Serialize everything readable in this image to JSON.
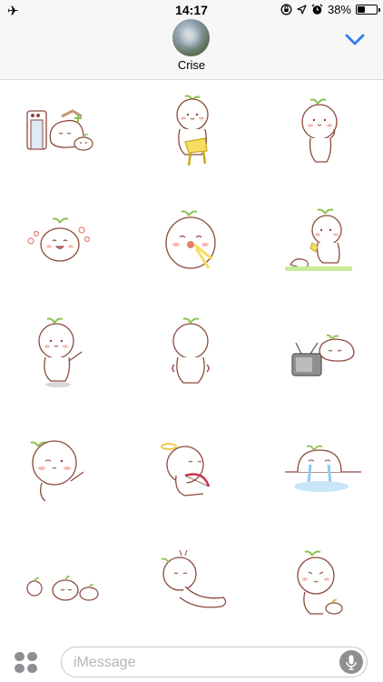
{
  "status_bar": {
    "time": "14:17",
    "battery_percent": "38%",
    "battery_level": 0.38,
    "left_icon": "airplane-icon",
    "right_icons": [
      "orientation-lock-icon",
      "location-icon",
      "alarm-icon",
      "battery-icon"
    ]
  },
  "header": {
    "contact_name": "Crise",
    "avatar": "contact-avatar-photo",
    "details_icon": "chevron-down-icon"
  },
  "stickers": [
    "sticker-sleeping-by-heater",
    "sticker-sitting-on-chair",
    "sticker-thinking",
    "sticker-flowers-happy",
    "sticker-eating-snack",
    "sticker-watering-sprout",
    "sticker-pointing",
    "sticker-back-view",
    "sticker-watching-tv",
    "sticker-winking-wave",
    "sticker-angel-bow",
    "sticker-crying-puddle",
    "sticker-family-row",
    "sticker-lying-down",
    "sticker-feeding-baby"
  ],
  "input": {
    "placeholder": "iMessage",
    "apps_icon": "app-drawer-icon",
    "mic_icon": "microphone-icon"
  },
  "colors": {
    "line": "#8b4a3c",
    "leaf": "#8cc152",
    "blush": "#f7b8b0",
    "accent_blue": "#2f7cf6",
    "grey": "#8e8e93"
  }
}
